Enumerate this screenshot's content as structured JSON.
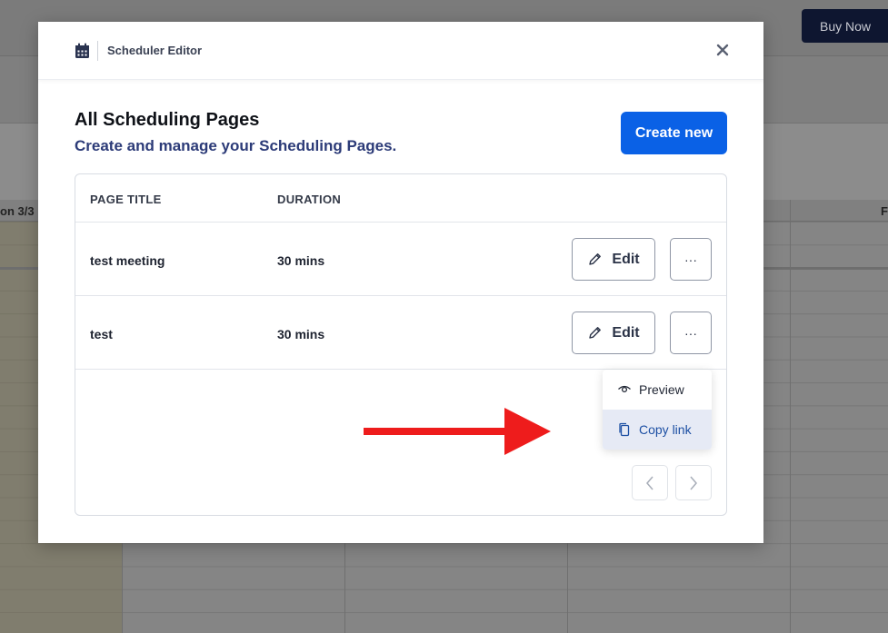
{
  "background": {
    "buy_now_label": "Buy Now",
    "day_header_left": "on 3/3",
    "day_header_right": "F"
  },
  "modal": {
    "header_icon": "calendar-icon",
    "header_title": "Scheduler Editor",
    "close_icon": "close-icon",
    "heading": "All Scheduling Pages",
    "subheading": "Create and manage your Scheduling Pages.",
    "create_label": "Create new",
    "table": {
      "columns": [
        "PAGE TITLE",
        "DURATION"
      ],
      "rows": [
        {
          "title": "test meeting",
          "duration": "30 mins",
          "edit_label": "Edit",
          "more_label": "···"
        },
        {
          "title": "test",
          "duration": "30 mins",
          "edit_label": "Edit",
          "more_label": "···"
        }
      ]
    },
    "menu": {
      "items": [
        {
          "label": "Preview",
          "icon": "eye-icon"
        },
        {
          "label": "Copy link",
          "icon": "copy-icon",
          "active": true
        }
      ]
    }
  },
  "colors": {
    "primary": "#0a61e6",
    "subheading": "#2c3b78",
    "arrow": "#ee1c1c",
    "menu_active_bg": "#e6eaf5"
  }
}
